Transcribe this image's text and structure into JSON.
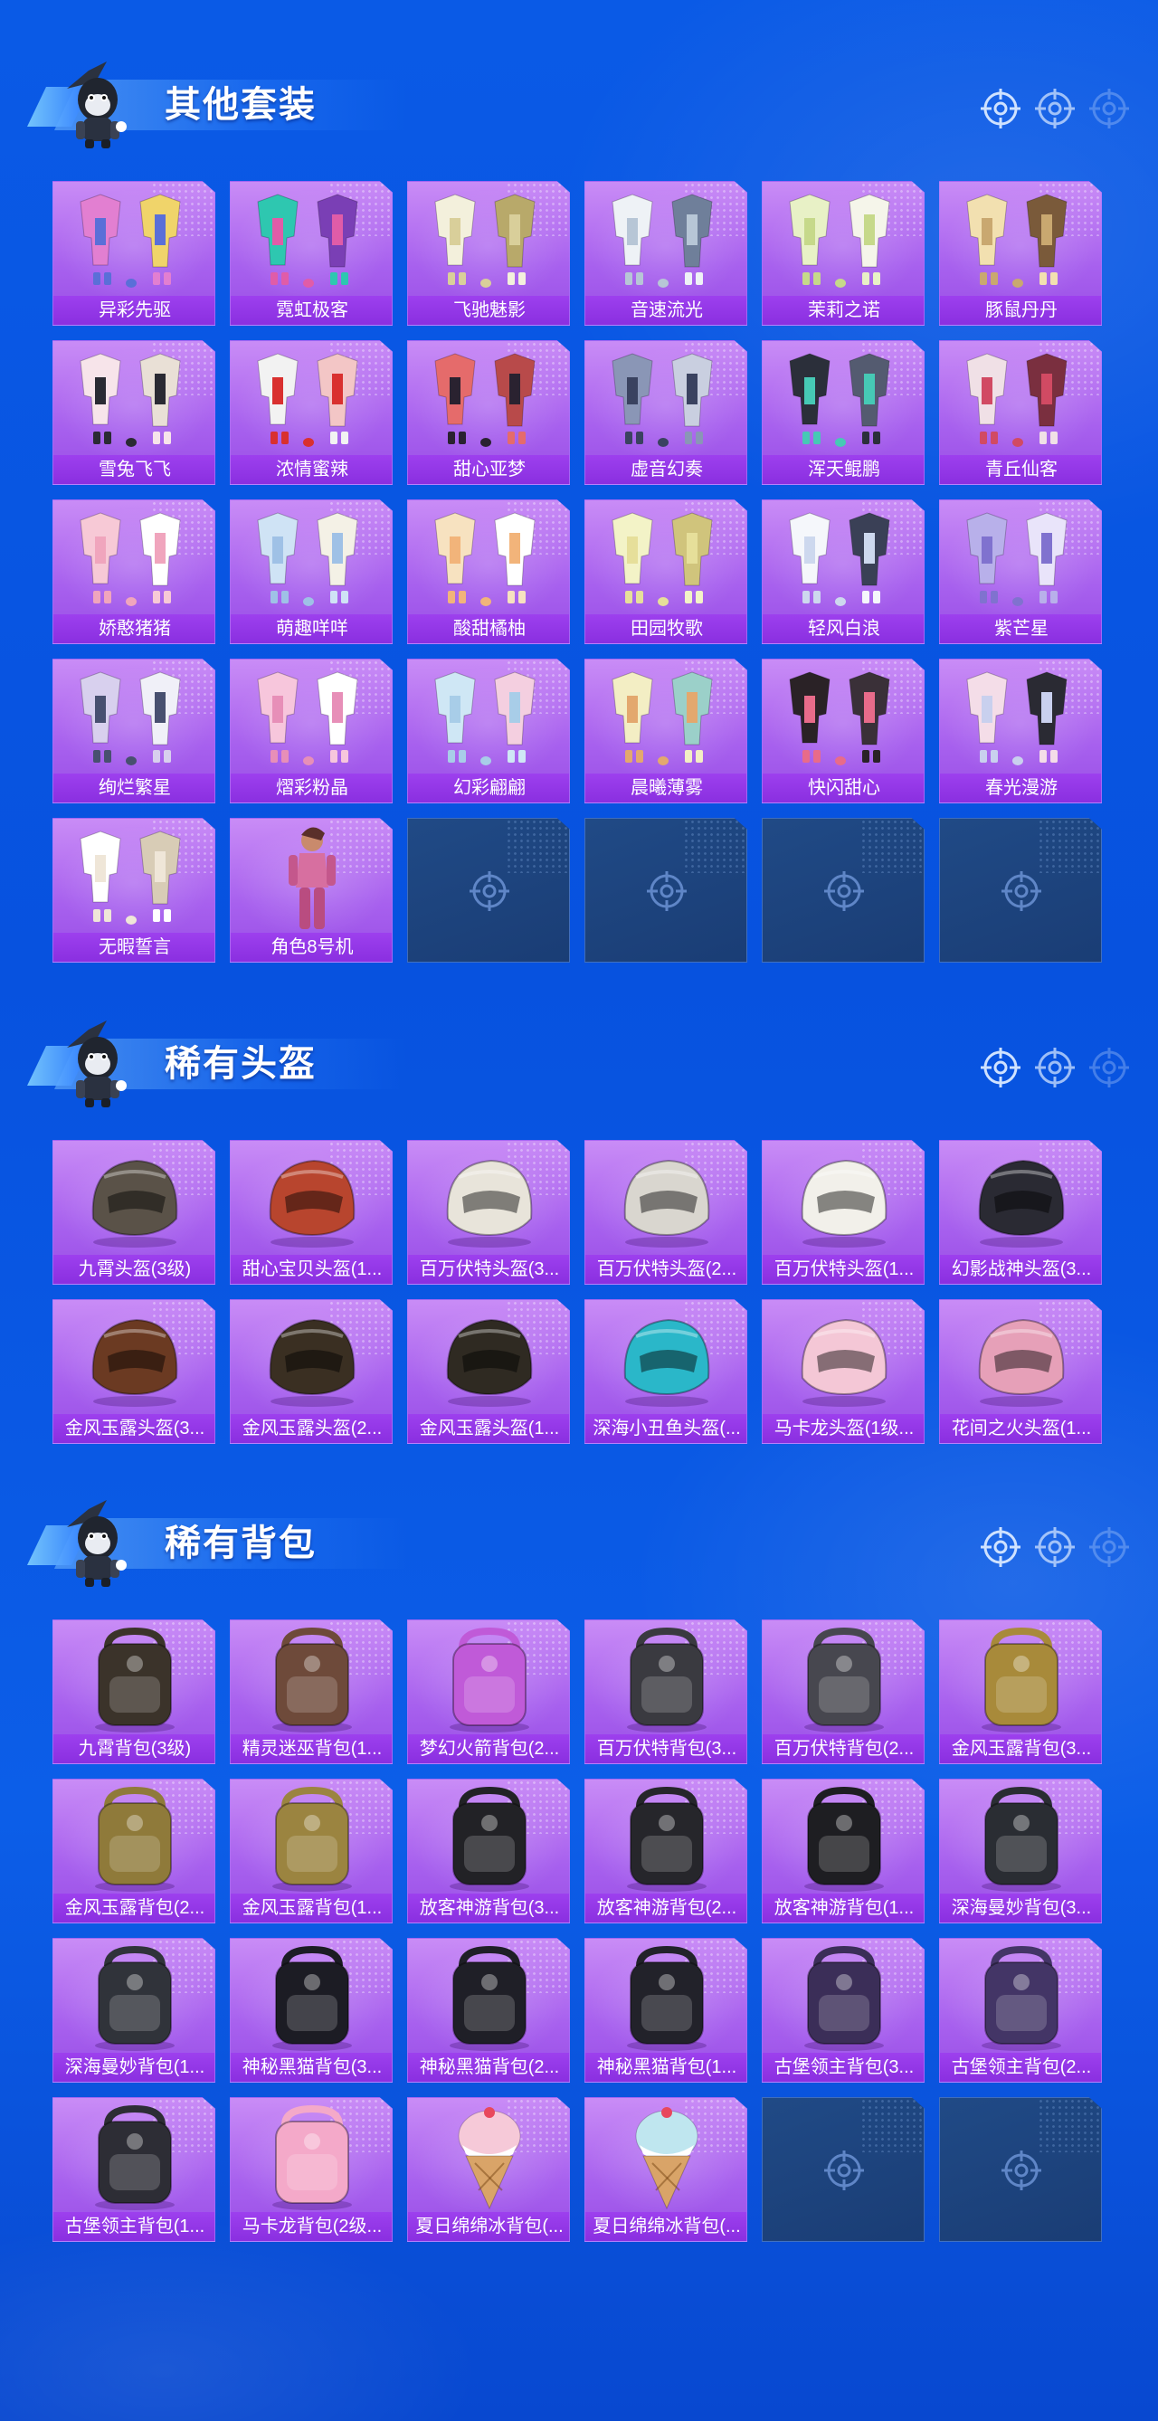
{
  "colors": {
    "background": "#0a5ae6",
    "card": "#a760ee",
    "card_label": "#8a2fe0",
    "empty_card": "#1f4682",
    "title_text": "#ffffff"
  },
  "sections": [
    {
      "title": "其他套装",
      "icon": "mascot-icon",
      "items": [
        {
          "label": "异彩先驱",
          "art": "outfit"
        },
        {
          "label": "霓虹极客",
          "art": "outfit"
        },
        {
          "label": "飞驰魅影",
          "art": "outfit"
        },
        {
          "label": "音速流光",
          "art": "outfit"
        },
        {
          "label": "茉莉之诺",
          "art": "outfit"
        },
        {
          "label": "豚鼠丹丹",
          "art": "outfit"
        },
        {
          "label": "雪兔飞飞",
          "art": "outfit"
        },
        {
          "label": "浓情蜜辣",
          "art": "outfit"
        },
        {
          "label": "甜心亚梦",
          "art": "outfit"
        },
        {
          "label": "虚音幻奏",
          "art": "outfit"
        },
        {
          "label": "浑天鲲鹏",
          "art": "outfit"
        },
        {
          "label": "青丘仙客",
          "art": "outfit"
        },
        {
          "label": "娇憨猪猪",
          "art": "outfit"
        },
        {
          "label": "萌趣咩咩",
          "art": "outfit"
        },
        {
          "label": "酸甜橘柚",
          "art": "outfit"
        },
        {
          "label": "田园牧歌",
          "art": "outfit"
        },
        {
          "label": "轻风白浪",
          "art": "outfit"
        },
        {
          "label": "紫芒星",
          "art": "outfit"
        },
        {
          "label": "绚烂繁星",
          "art": "outfit"
        },
        {
          "label": "熠彩粉晶",
          "art": "outfit"
        },
        {
          "label": "幻彩翩翩",
          "art": "outfit"
        },
        {
          "label": "晨曦薄雾",
          "art": "outfit"
        },
        {
          "label": "快闪甜心",
          "art": "outfit"
        },
        {
          "label": "春光漫游",
          "art": "outfit"
        },
        {
          "label": "无暇誓言",
          "art": "outfit"
        },
        {
          "label": "角色8号机",
          "art": "figure"
        },
        {
          "empty": true,
          "icon": "crosshair-icon"
        },
        {
          "empty": true,
          "icon": "crosshair-icon"
        },
        {
          "empty": true,
          "icon": "crosshair-icon"
        },
        {
          "empty": true,
          "icon": "crosshair-icon"
        }
      ]
    },
    {
      "title": "稀有头盔",
      "icon": "mascot-icon",
      "items": [
        {
          "label": "九霄头盔(3级)",
          "art": "helmet",
          "tint": "#5a5248"
        },
        {
          "label": "甜心宝贝头盔(1...",
          "art": "helmet",
          "tint": "#b8452e"
        },
        {
          "label": "百万伏特头盔(3...",
          "art": "helmet",
          "tint": "#e8e4da"
        },
        {
          "label": "百万伏特头盔(2...",
          "art": "helmet",
          "tint": "#d9d6cf"
        },
        {
          "label": "百万伏特头盔(1...",
          "art": "helmet",
          "tint": "#f2f0ea"
        },
        {
          "label": "幻影战神头盔(3...",
          "art": "helmet",
          "tint": "#2a2a33"
        },
        {
          "label": "金风玉露头盔(3...",
          "art": "helmet",
          "tint": "#6b3a22"
        },
        {
          "label": "金风玉露头盔(2...",
          "art": "helmet",
          "tint": "#3a2f22"
        },
        {
          "label": "金风玉露头盔(1...",
          "art": "helmet",
          "tint": "#2f2a22"
        },
        {
          "label": "深海小丑鱼头盔(...",
          "art": "helmet",
          "tint": "#2ab7c9"
        },
        {
          "label": "马卡龙头盔(1级...",
          "art": "helmet",
          "tint": "#f4c7d6"
        },
        {
          "label": "花间之火头盔(1...",
          "art": "helmet",
          "tint": "#e6a0b8"
        }
      ]
    },
    {
      "title": "稀有背包",
      "icon": "mascot-icon",
      "items": [
        {
          "label": "九霄背包(3级)",
          "art": "backpack",
          "tint": "#3b332a"
        },
        {
          "label": "精灵迷巫背包(1...",
          "art": "backpack",
          "tint": "#6e4a3a"
        },
        {
          "label": "梦幻火箭背包(2...",
          "art": "backpack",
          "tint": "#c05ad8"
        },
        {
          "label": "百万伏特背包(3...",
          "art": "backpack",
          "tint": "#3a3a40"
        },
        {
          "label": "百万伏特背包(2...",
          "art": "backpack",
          "tint": "#47474f"
        },
        {
          "label": "金风玉露背包(3...",
          "art": "backpack",
          "tint": "#a88a3a"
        },
        {
          "label": "金风玉露背包(2...",
          "art": "backpack",
          "tint": "#8f7a3a"
        },
        {
          "label": "金风玉露背包(1...",
          "art": "backpack",
          "tint": "#9b8440"
        },
        {
          "label": "放客神游背包(3...",
          "art": "backpack",
          "tint": "#222226"
        },
        {
          "label": "放客神游背包(2...",
          "art": "backpack",
          "tint": "#26262b"
        },
        {
          "label": "放客神游背包(1...",
          "art": "backpack",
          "tint": "#1e1e22"
        },
        {
          "label": "深海曼妙背包(3...",
          "art": "backpack",
          "tint": "#2a2d33"
        },
        {
          "label": "深海曼妙背包(1...",
          "art": "backpack",
          "tint": "#30333a"
        },
        {
          "label": "神秘黑猫背包(3...",
          "art": "backpack",
          "tint": "#1c1c24"
        },
        {
          "label": "神秘黑猫背包(2...",
          "art": "backpack",
          "tint": "#1f1f27"
        },
        {
          "label": "神秘黑猫背包(1...",
          "art": "backpack",
          "tint": "#22222a"
        },
        {
          "label": "古堡领主背包(3...",
          "art": "backpack",
          "tint": "#3b2e58"
        },
        {
          "label": "古堡领主背包(2...",
          "art": "backpack",
          "tint": "#433566"
        },
        {
          "label": "古堡领主背包(1...",
          "art": "backpack",
          "tint": "#2d2d35"
        },
        {
          "label": "马卡龙背包(2级...",
          "art": "backpack",
          "tint": "#f4a9c9"
        },
        {
          "label": "夏日绵绵冰背包(...",
          "art": "icecream",
          "tint": "#f6c9d8"
        },
        {
          "label": "夏日绵绵冰背包(...",
          "art": "icecream",
          "tint": "#bfe6ef"
        },
        {
          "empty": true,
          "icon": "crosshair-icon"
        },
        {
          "empty": true,
          "icon": "crosshair-icon"
        }
      ]
    }
  ]
}
